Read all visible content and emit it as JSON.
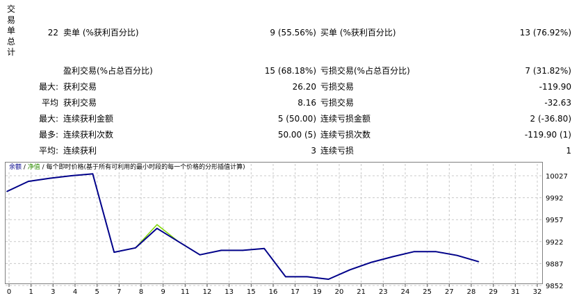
{
  "section_title_chars": [
    "交",
    "易",
    "单",
    "总",
    "计"
  ],
  "summary": {
    "total_trades": "22",
    "short_label": "卖单 (%获利百分比)",
    "short_value": "9 (55.56%)",
    "long_label": "买单 (%获利百分比)",
    "long_value": "13 (76.92%)"
  },
  "rows": [
    {
      "prefix": "",
      "label1": "盈利交易(%占总百分比)",
      "value1": "15 (68.18%)",
      "label2": "亏损交易(%占总百分比)",
      "value2": "7 (31.82%)"
    },
    {
      "prefix": "最大:",
      "label1": "获利交易",
      "value1": "26.20",
      "label2": "亏损交易",
      "value2": "-119.90"
    },
    {
      "prefix": "平均",
      "label1": "获利交易",
      "value1": "8.16",
      "label2": "亏损交易",
      "value2": "-32.63"
    },
    {
      "prefix": "最大:",
      "label1": "连续获利金额",
      "value1": "5 (50.00)",
      "label2": "连续亏损金额",
      "value2": "2 (-36.80)"
    },
    {
      "prefix": "最多:",
      "label1": "连续获利次数",
      "value1": "50.00 (5)",
      "label2": "连续亏损次数",
      "value2": "-119.90 (1)"
    },
    {
      "prefix": "平均:",
      "label1": "连续获利",
      "value1": "3",
      "label2": "连续亏损",
      "value2": "1"
    }
  ],
  "legend": {
    "balance": "余额",
    "sep1": " / ",
    "equity": "净值",
    "rest": " / 每个即时价格(基于所有可利用的最小时段的每一个价格的分形插值计算)"
  },
  "colors": {
    "balance": "#00008b",
    "equity": "#7fd700",
    "grid": "#c8c8c8"
  },
  "chart_data": {
    "type": "line",
    "y_ticks": [
      "10027",
      "9992",
      "9957",
      "9922",
      "9887",
      "9852"
    ],
    "x_ticks": [
      "0",
      "1",
      "3",
      "4",
      "5",
      "7",
      "8",
      "9",
      "11",
      "12",
      "13",
      "15",
      "16",
      "17",
      "19",
      "20",
      "21",
      "23",
      "24",
      "25",
      "27",
      "28",
      "29",
      "31",
      "32"
    ],
    "ylim": [
      9852,
      10027
    ],
    "xlim": [
      0,
      25
    ],
    "grid": true,
    "series": [
      {
        "name": "余额",
        "x": [
          0,
          1,
          2,
          3,
          4,
          5,
          6,
          7,
          8,
          9,
          10,
          11,
          12,
          13,
          14,
          15,
          16,
          17,
          18,
          19,
          20,
          21,
          22
        ],
        "y": [
          10002,
          10018,
          10023,
          10027,
          10030,
          9905,
          9912,
          9943,
          9922,
          9901,
          9908,
          9908,
          9911,
          9866,
          9866,
          9862,
          9877,
          9889,
          9898,
          9906,
          9906,
          9900,
          9890
        ]
      },
      {
        "name": "净值",
        "x": [
          0,
          1,
          2,
          3,
          4,
          5,
          6,
          7,
          8,
          9,
          10,
          11,
          12,
          13,
          14,
          15,
          16,
          17,
          18,
          19,
          20,
          21,
          22
        ],
        "y": [
          10002,
          10018,
          10023,
          10027,
          10030,
          9905,
          9912,
          9949,
          9922,
          9901,
          9908,
          9908,
          9911,
          9866,
          9866,
          9862,
          9877,
          9889,
          9898,
          9906,
          9906,
          9900,
          9890
        ]
      }
    ]
  }
}
